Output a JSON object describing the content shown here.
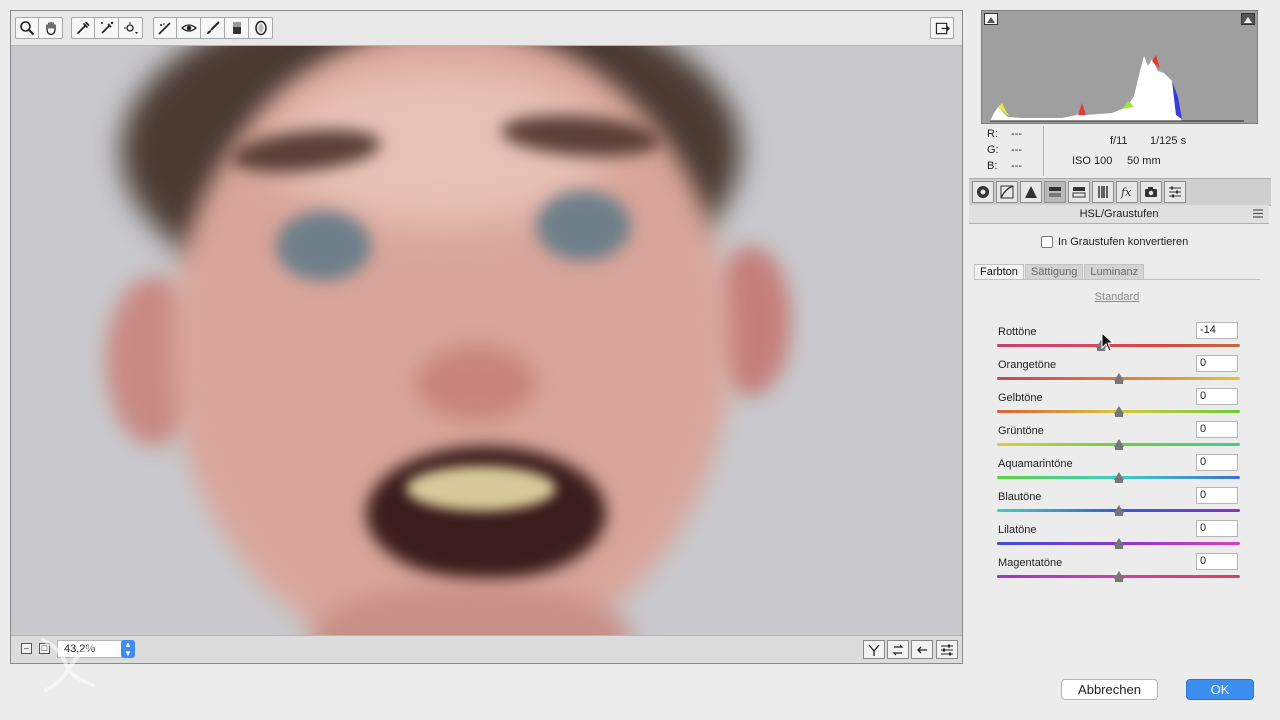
{
  "toolbar": {
    "tools": [
      "zoom-icon",
      "hand-icon",
      "eyedropper-icon",
      "color-sampler-icon",
      "targeted-adjustment-icon",
      "straighten-icon",
      "red-eye-icon",
      "adjustment-brush-icon",
      "graduated-filter-icon",
      "radial-filter-icon"
    ]
  },
  "statusbar": {
    "zoom": "43,2%"
  },
  "readout": {
    "r_label": "R:",
    "r_value": "---",
    "g_label": "G:",
    "g_value": "---",
    "b_label": "B:",
    "b_value": "---",
    "aperture": "f/11",
    "shutter": "1/125 s",
    "iso": "ISO 100",
    "focal": "50 mm"
  },
  "panel": {
    "section_title": "HSL/Graustufen",
    "grayscale_label": "In Graustufen konvertieren",
    "grayscale_checked": false,
    "subtabs": [
      "Farbton",
      "Sättigung",
      "Luminanz"
    ],
    "active_subtab": "Farbton",
    "standard_link": "Standard",
    "sliders": [
      {
        "label": "Rottöne",
        "value": "-14",
        "min": -100,
        "max": 100,
        "colors": [
          "#c6416d",
          "#d8466a",
          "#d8463f",
          "#c76a3c"
        ]
      },
      {
        "label": "Orangetöne",
        "value": "0",
        "min": -100,
        "max": 100,
        "colors": [
          "#c8415c",
          "#e07a3a",
          "#d8c640"
        ]
      },
      {
        "label": "Gelbtöne",
        "value": "0",
        "min": -100,
        "max": 100,
        "colors": [
          "#d9603a",
          "#d8c63c",
          "#6fcc3d"
        ]
      },
      {
        "label": "Grüntöne",
        "value": "0",
        "min": -100,
        "max": 100,
        "colors": [
          "#d6d23c",
          "#6fd03c",
          "#3fcc8a"
        ]
      },
      {
        "label": "Aquamarintöne",
        "value": "0",
        "min": -100,
        "max": 100,
        "colors": [
          "#5fcf3f",
          "#3fcfc5",
          "#3a6fd8"
        ]
      },
      {
        "label": "Blautöne",
        "value": "0",
        "min": -100,
        "max": 100,
        "colors": [
          "#3fd0c0",
          "#3a5ad8",
          "#8a2fc8"
        ]
      },
      {
        "label": "Lilatöne",
        "value": "0",
        "min": -100,
        "max": 100,
        "colors": [
          "#3a4fd8",
          "#8a35d0",
          "#d83fc0"
        ]
      },
      {
        "label": "Magentatöne",
        "value": "0",
        "min": -100,
        "max": 100,
        "colors": [
          "#9a35d0",
          "#d53fa8",
          "#d8405a"
        ]
      }
    ]
  },
  "buttons": {
    "cancel": "Abbrechen",
    "ok": "OK"
  }
}
